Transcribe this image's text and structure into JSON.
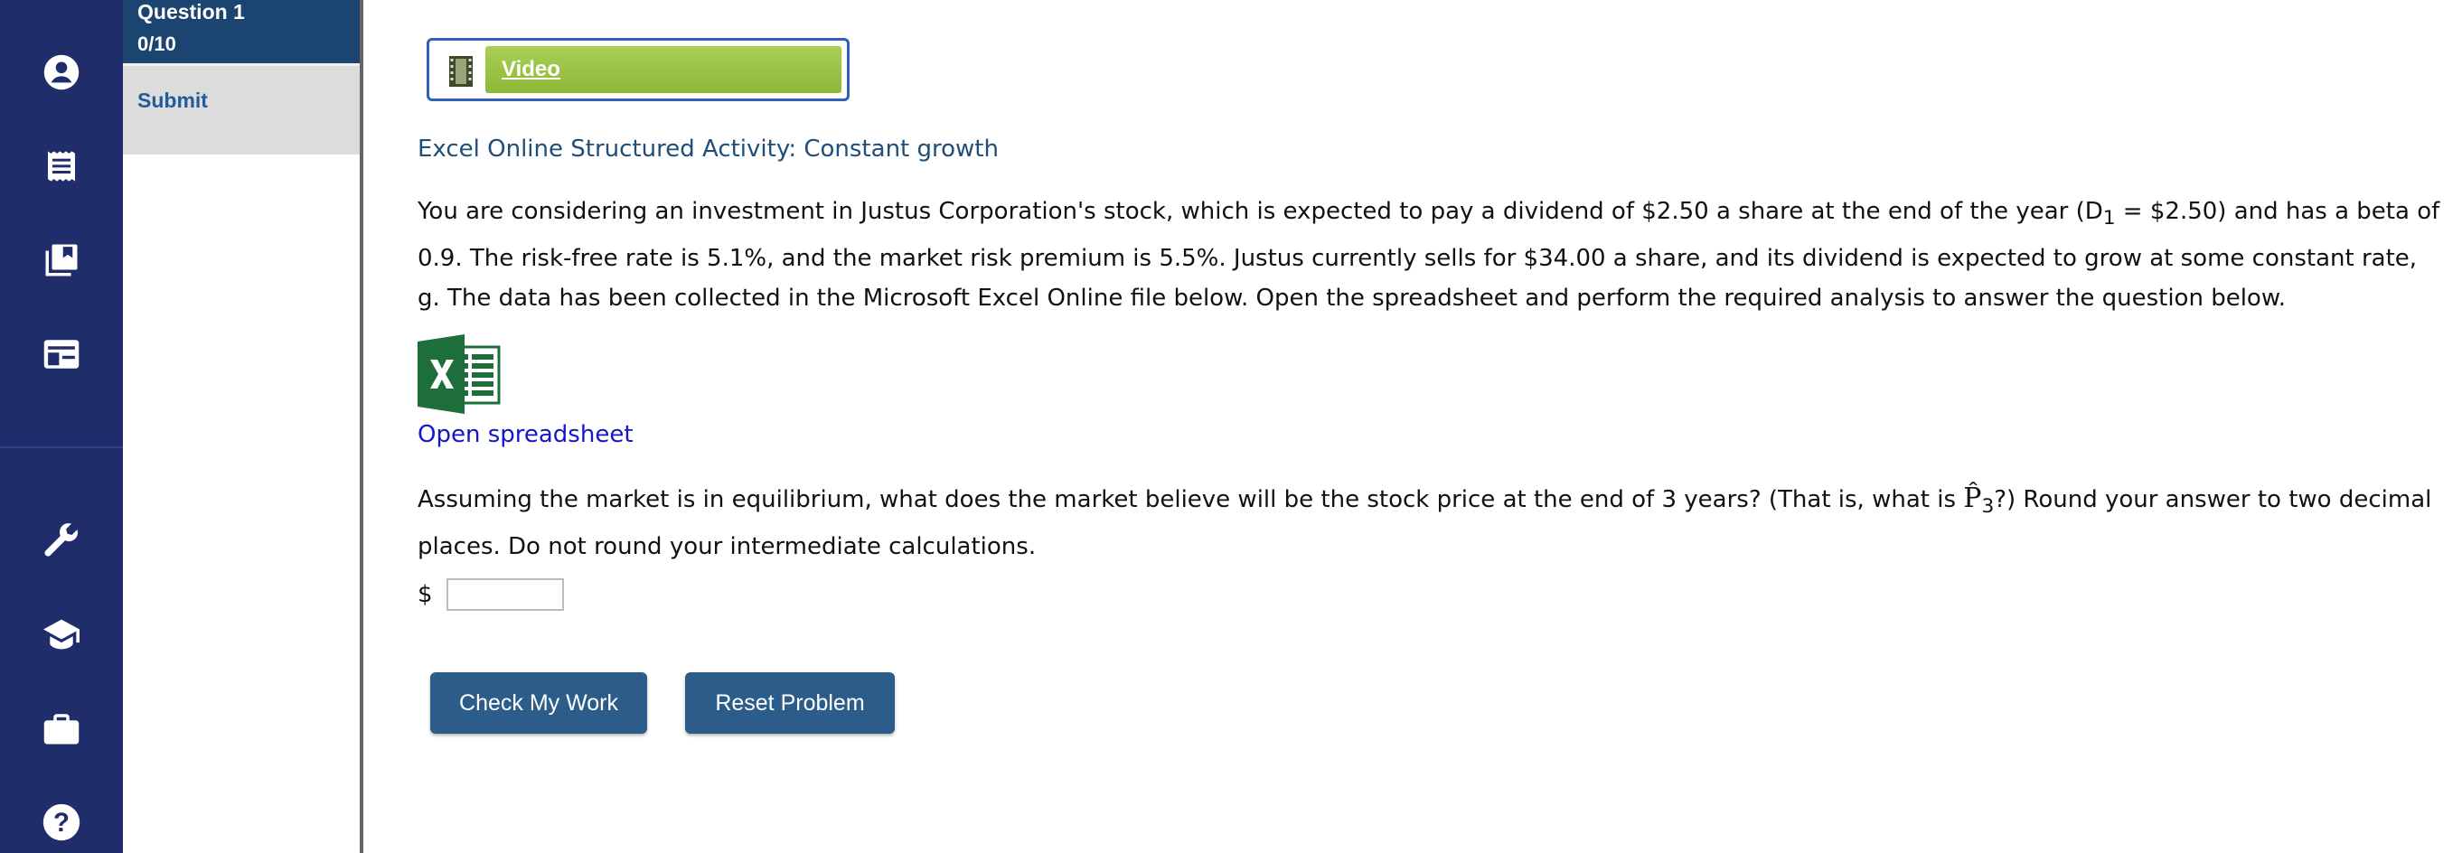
{
  "sidebar": {
    "icons": [
      "account-icon",
      "receipt-icon",
      "library-icon",
      "dashboard-icon",
      "wrench-icon",
      "graduation-cap-icon",
      "briefcase-icon",
      "help-icon"
    ]
  },
  "question_panel": {
    "title": "Question 1",
    "score": "0/10",
    "submit_label": "Submit"
  },
  "video": {
    "label": "Video"
  },
  "activity": {
    "title": "Excel Online Structured Activity: Constant growth",
    "para_part1": "You are considering an investment in Justus Corporation's stock, which is expected to pay a dividend of $2.50 a share at the end of the year (D",
    "para_sub": "1",
    "para_part2": " = $2.50) and has a beta of 0.9. The risk-free rate is 5.1%, and the market risk premium is 5.5%. Justus currently sells for $34.00 a share, and its dividend is expected to grow at some constant rate, g. The data has been collected in the Microsoft Excel Online file below. Open the spreadsheet and perform the required analysis to answer the question below.",
    "open_spreadsheet": "Open spreadsheet",
    "question_part1": "Assuming the market is in equilibrium, what does the market believe will be the stock price at the end of 3 years? (That is, what is ",
    "p_hat": "P̂",
    "p_sub": "3",
    "question_part2": "?) Round your answer to two decimal places. Do not round your intermediate calculations.",
    "currency_symbol": "$",
    "answer_value": ""
  },
  "buttons": {
    "check_label": "Check My Work",
    "reset_label": "Reset Problem"
  },
  "colors": {
    "rail": "#1f2d6b",
    "header": "#1b4470",
    "button": "#2b5c8a",
    "video_green": "#9cc548",
    "excel_green": "#1e6e3b"
  }
}
